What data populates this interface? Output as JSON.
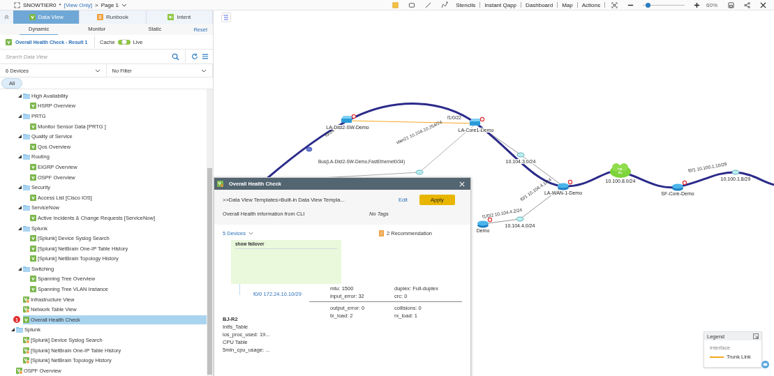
{
  "top_bar": {
    "title": "SNOWTIER0",
    "modified_mark": "*",
    "mode": "[View Only]",
    "separator": ">",
    "page": "Page 1"
  },
  "toolbar": {
    "tools": [
      {
        "kind": "note"
      },
      {
        "kind": "rectangle"
      },
      {
        "kind": "line"
      },
      {
        "kind": "curve"
      }
    ],
    "menu": [
      "Stencils",
      "Instant Qapp",
      "Dashboard",
      "Map",
      "Actions"
    ],
    "zoom": {
      "level": 0.12,
      "reading": "60%"
    }
  },
  "panel_tabs": [
    {
      "label": "Data View",
      "kind": "view",
      "selected": true
    },
    {
      "label": "Runbook",
      "kind": "runbook",
      "selected": false
    },
    {
      "label": "Intent",
      "kind": "intent",
      "selected": false
    }
  ],
  "sub_tabs": [
    {
      "label": "Dynamic",
      "selected": true
    },
    {
      "label": "Monitor",
      "selected": false
    },
    {
      "label": "Static",
      "selected": false
    }
  ],
  "reset_link": "Reset",
  "result": {
    "label": "Overall Health Check - Result 1"
  },
  "cache_toggle": {
    "left": "Cache",
    "right": "Live",
    "on": true
  },
  "search": {
    "placeholder": "Search Data View"
  },
  "device_filter": {
    "value": "6 Devices"
  },
  "type_filter": {
    "value": "No Filter"
  },
  "chips": [
    {
      "label": "All",
      "selected": true
    }
  ],
  "tree": {
    "scrolled_children": [
      {
        "label": "High Availability",
        "kind": "folder",
        "expanded": true,
        "selected": false,
        "children": [
          {
            "label": "HSRP Overview",
            "kind": "view",
            "selected": false
          }
        ]
      },
      {
        "label": "PRTG",
        "kind": "folder",
        "expanded": true,
        "selected": false,
        "children": [
          {
            "label": "Monitor Sensor Data [PRTG ]",
            "kind": "view",
            "selected": false
          }
        ]
      },
      {
        "label": "Quality of Service",
        "kind": "folder",
        "expanded": true,
        "selected": false,
        "children": [
          {
            "label": "Qos Overview",
            "kind": "view",
            "selected": false
          }
        ]
      },
      {
        "label": "Routing",
        "kind": "folder",
        "expanded": true,
        "selected": false,
        "children": [
          {
            "label": "EIGRP Overview",
            "kind": "view",
            "selected": false
          },
          {
            "label": "OSPF Overview",
            "kind": "view",
            "selected": false
          }
        ]
      },
      {
        "label": "Security",
        "kind": "folder",
        "expanded": true,
        "selected": false,
        "children": [
          {
            "label": "Access List [Cisco IOS]",
            "kind": "view",
            "selected": false
          }
        ]
      },
      {
        "label": "ServiceNow",
        "kind": "folder",
        "expanded": true,
        "selected": false,
        "children": [
          {
            "label": "Active Incidents & Change Requests [ServiceNow]",
            "kind": "view",
            "selected": false
          }
        ]
      },
      {
        "label": "Splunk",
        "kind": "folder",
        "expanded": true,
        "selected": false,
        "children": [
          {
            "label": "[Splunk] Device Syslog Search",
            "kind": "view",
            "selected": false
          },
          {
            "label": "[Splunk] NetBrain One-IP Table History",
            "kind": "view",
            "selected": false
          },
          {
            "label": "[Splunk] NetBrain Topology History",
            "kind": "view",
            "selected": false
          }
        ]
      },
      {
        "label": "Switching",
        "kind": "folder",
        "expanded": true,
        "selected": false,
        "children": [
          {
            "label": "Spanning Tree Overview",
            "kind": "view",
            "selected": false
          },
          {
            "label": "Spanning Tree VLAN Instance",
            "kind": "view",
            "selected": false
          }
        ]
      },
      {
        "label": "Infrastructure View",
        "kind": "shared_view",
        "selected": false
      },
      {
        "label": "Network Table View",
        "kind": "shared_view",
        "selected": false
      },
      {
        "label": "Overall Health Check",
        "kind": "view",
        "selected": true,
        "badge": "1"
      }
    ],
    "items": [
      {
        "label": "Splunk",
        "kind": "folder",
        "expanded": true,
        "selected": false,
        "children": [
          {
            "label": "[Splunk] Device Syslog Search",
            "kind": "shared_view",
            "selected": false
          },
          {
            "label": "[Splunk] NetBrain One-IP Table History",
            "kind": "shared_view",
            "selected": false
          },
          {
            "label": "[Splunk] NetBrain Topology History",
            "kind": "shared_view",
            "selected": false
          }
        ]
      },
      {
        "label": "OSPF Overview",
        "kind": "shared_view",
        "selected": false
      }
    ]
  },
  "map": {
    "nodes": [
      {
        "label": "LA-Dist2-SW-Demo",
        "kind": "switch"
      },
      {
        "label": "LA-Core1-Demo",
        "kind": "switch"
      },
      {
        "label": "LA-WAN-1-Demo",
        "kind": "router"
      },
      {
        "label": "10.100.8.0/24",
        "kind": "cloud"
      },
      {
        "label": "SF-Core-Demo",
        "kind": "router"
      },
      {
        "label": "10.104.3.0/24",
        "kind": "hub"
      },
      {
        "label": "10.100.1.8/29",
        "kind": "hub"
      },
      {
        "label": "10.104.4.0/24",
        "kind": "hub"
      },
      {
        "label": "Demo",
        "kind": "router"
      }
    ],
    "link_labels": [
      "f0/34",
      "f1/0/22",
      "Bus(LA-Dist2-SW-Demo,FastEthernet0/34)",
      "vlan21 10.104.10.254/24",
      "f0/1 10.104.4.1/24",
      "f1/0/2 10.104.4.2/24",
      "f0/1 10.100.1.10/29"
    ]
  },
  "popup": {
    "title": "Overall Health Check",
    "path": ">>Data View Templates>Built-in Data View Templa...",
    "edit": "Edit",
    "apply": "Apply",
    "description": "Overall Health information from CLI",
    "tags": "No Tags",
    "devices": "5 Devices",
    "recommendation": "2 Recommendation",
    "command": "show failover",
    "interface": "f0/0 172.24.10.10/29",
    "stats_top": [
      "mtu: 1500",
      "duplex: Full-duplex",
      "input_error: 32",
      "crc: 0"
    ],
    "stats_bottom": [
      "output_error: 0",
      "collisions: 0",
      "tx_load: 2",
      "rx_load: 1"
    ],
    "device": "BJ-R2",
    "device_lines": [
      "Intfs_Table",
      "ios_proc_used: 19...",
      "CPU Table",
      "5min_cpu_usage: ..."
    ]
  },
  "legend": {
    "title": "Legend",
    "section": "Interface",
    "items": [
      {
        "label": "Trunk Link",
        "color": "#f5a623"
      }
    ]
  }
}
